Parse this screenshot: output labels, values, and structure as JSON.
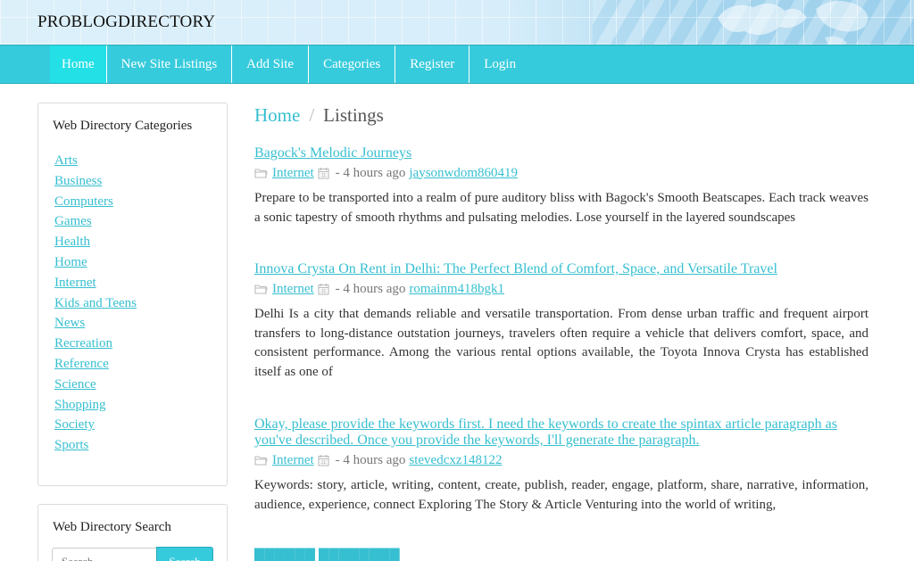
{
  "header": {
    "brand": "PROBLOGDIRECTORY"
  },
  "nav": [
    {
      "label": "Home",
      "active": true
    },
    {
      "label": "New Site Listings"
    },
    {
      "label": "Add Site"
    },
    {
      "label": "Categories"
    },
    {
      "label": "Register"
    },
    {
      "label": "Login"
    }
  ],
  "sidebar": {
    "categories_title": "Web Directory Categories",
    "categories": [
      "Arts",
      "Business",
      "Computers",
      "Games",
      "Health",
      "Home",
      "Internet",
      "Kids and Teens",
      "News",
      "Recreation",
      "Reference",
      "Science",
      "Shopping",
      "Society",
      "Sports"
    ],
    "search_title": "Web Directory Search",
    "search_placeholder": "Search",
    "search_button": "Search"
  },
  "breadcrumb": {
    "home": "Home",
    "separator": "/",
    "current": "Listings"
  },
  "listings": [
    {
      "title": "Bagock's Melodic Journeys",
      "category": "Internet",
      "time": "- 4 hours ago",
      "user": "jaysonwdom860419",
      "description": "Prepare to be transported into a realm of pure auditory bliss with Bagock's Smooth Beatscapes. Each track weaves a sonic tapestry of smooth rhythms and pulsating melodies. Lose yourself in the layered soundscapes"
    },
    {
      "title": "Innova Crysta On Rent in Delhi: The Perfect Blend of Comfort, Space, and Versatile Travel",
      "category": "Internet",
      "time": "- 4 hours ago",
      "user": "romainm418bgk1",
      "description": "Delhi Is a city that demands reliable and versatile transportation. From dense urban traffic and frequent airport transfers to long-distance outstation journeys, travelers often require a vehicle that delivers comfort, space, and consistent performance. Among the various rental options available, the Toyota Innova Crysta has established itself as one of"
    },
    {
      "title": "Okay, please provide the keywords first. I need the keywords to create the spintax article paragraph as you've described. Once you provide the keywords, I'll generate the paragraph.",
      "category": "Internet",
      "time": "- 4 hours ago",
      "user": "stevedcxz148122",
      "description": "Keywords: story, article, writing, content, create, publish, reader, engage, platform, share, narrative, information, audience, experience, connect Exploring The Story & Article Venturing into the world of writing,"
    },
    {
      "title": "██████ ████████"
    }
  ],
  "colors": {
    "accent": "#36cbdc",
    "link": "#36bfd0",
    "nav_active": "#22e0e6"
  }
}
